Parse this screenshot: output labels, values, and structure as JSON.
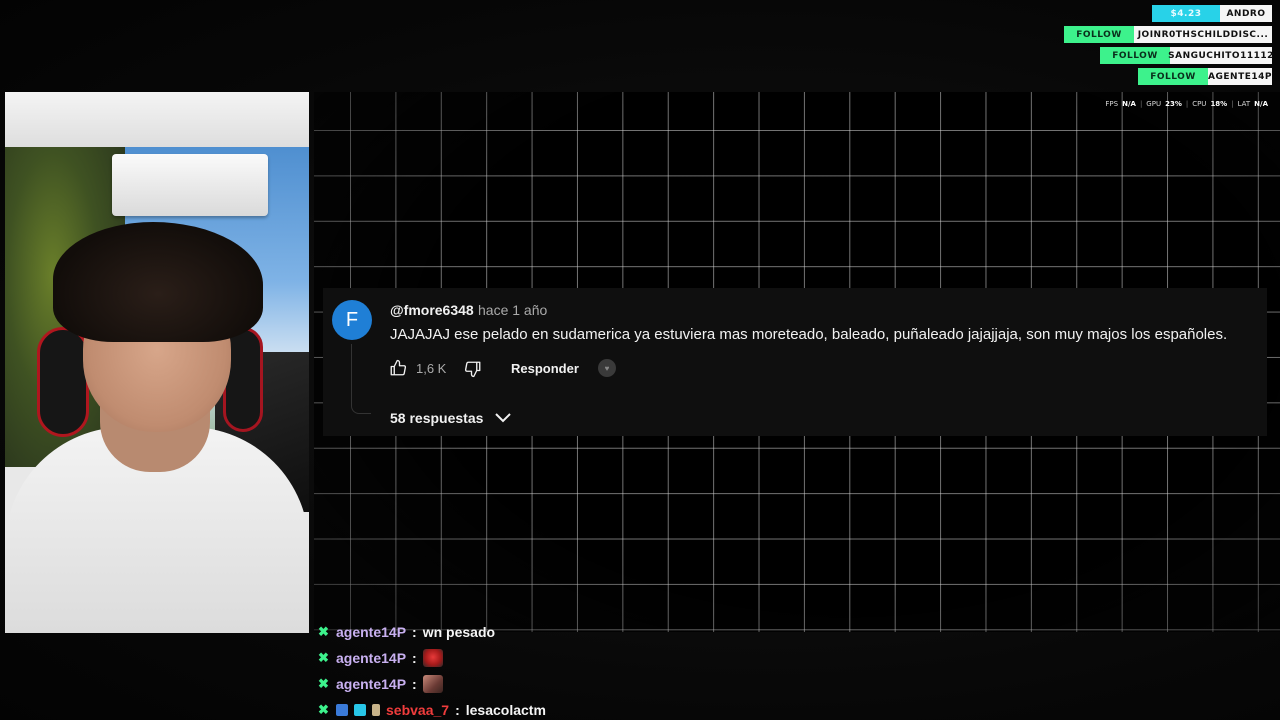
{
  "overlay": {
    "donation": {
      "amount": "$4.23",
      "user": "ANDRO"
    },
    "follows": [
      {
        "label": "FOLLOW",
        "user": "JOINR0THSCHILDDISC..."
      },
      {
        "label": "FOLLOW",
        "user": "SANGUCHITO11112"
      },
      {
        "label": "FOLLOW",
        "user": "AGENTE14P"
      }
    ],
    "stats": {
      "fps_label": "FPS",
      "fps_value": "N/A",
      "gpu_label": "GPU",
      "gpu_value": "23%",
      "cpu_label": "CPU",
      "cpu_value": "18%",
      "lat_label": "LAT",
      "lat_value": "N/A",
      "separator": "|"
    }
  },
  "comment": {
    "avatar_letter": "F",
    "avatar_color": "#1f7fd6",
    "handle": "@fmore6348",
    "time": "hace 1 año",
    "text": "JAJAJAJ ese pelado en sudamerica ya estuviera mas moreteado, baleado, puñaleado jajajjaja, son muy majos los españoles.",
    "likes": "1,6 K",
    "reply_label": "Responder",
    "replies_label": "58 respuestas"
  },
  "chat": [
    {
      "user": "agente14P",
      "sep": ":",
      "message": "wn pesado"
    },
    {
      "user": "agente14P",
      "sep": ":",
      "message": ""
    },
    {
      "user": "agente14P",
      "sep": ":",
      "message": ""
    },
    {
      "user": "sebvaa_7",
      "sep": ":",
      "message": "lesacolactm"
    }
  ],
  "colors": {
    "follow_green": "#3df28c",
    "donation_cyan": "#28d2e8",
    "chat_user_purple": "#c8b0f0",
    "chat_user_red": "#f03c3c"
  }
}
